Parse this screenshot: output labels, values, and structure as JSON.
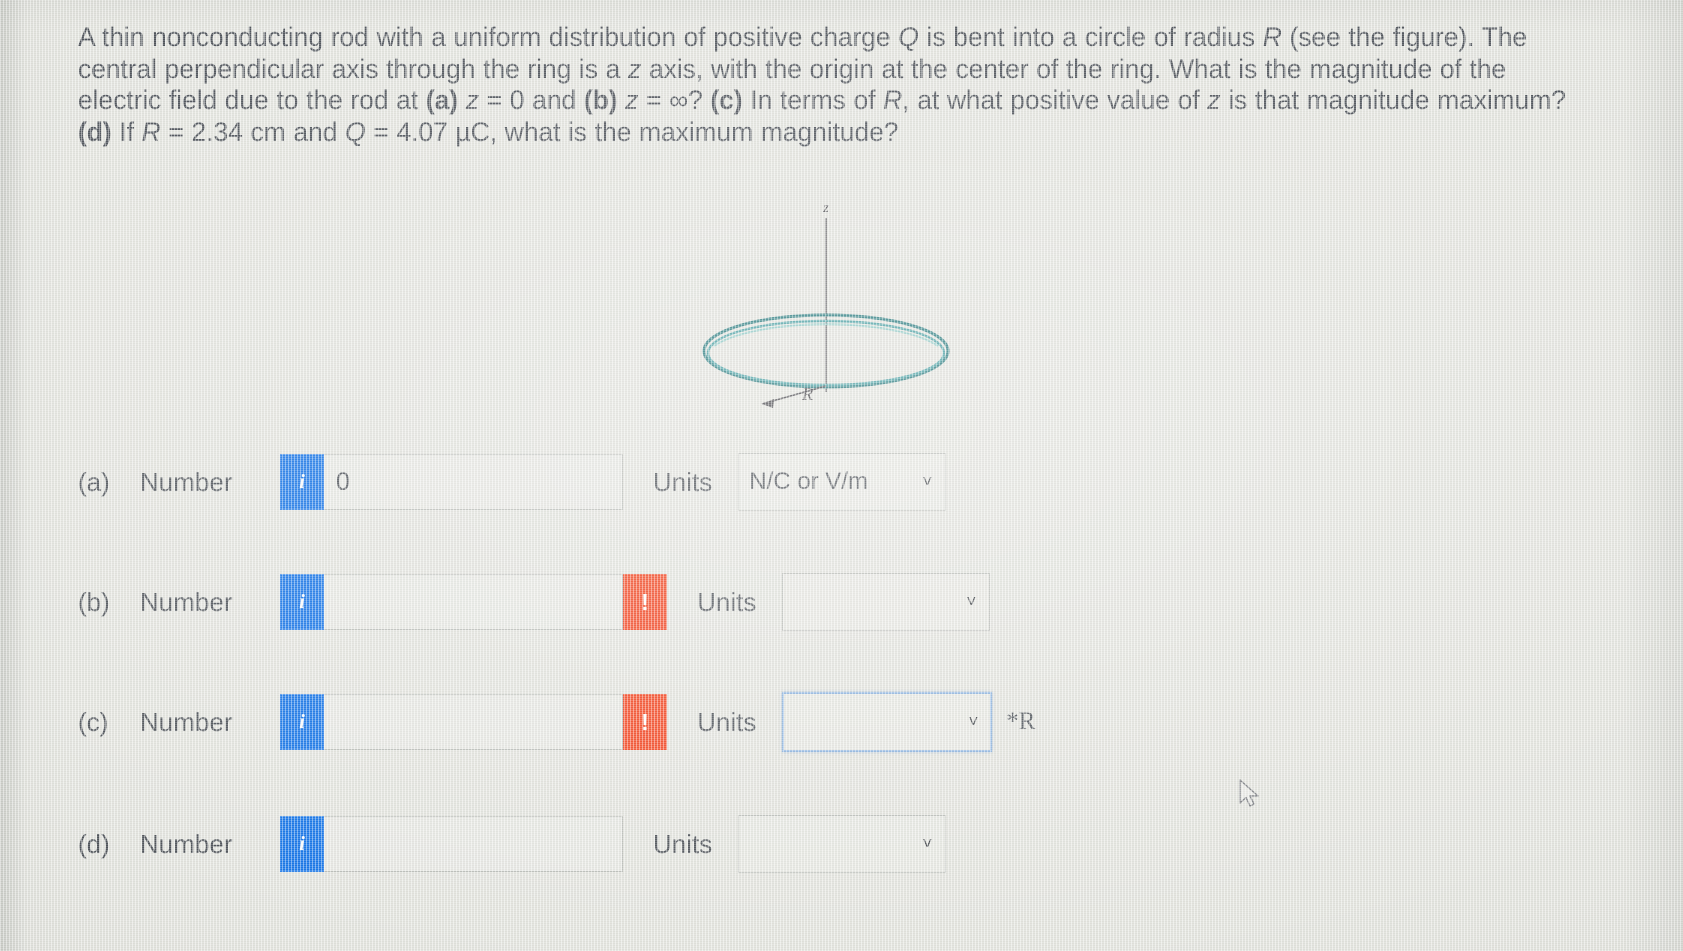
{
  "problem": {
    "line1_a": "A thin nonconducting rod with a uniform distribution of positive charge ",
    "q1": "Q",
    "line1_b": " is bent into a circle of radius ",
    "r1": "R",
    "line1_c": " (see the figure). The central",
    "line2_a": "perpendicular axis through the ring is a ",
    "z1": "z",
    "line2_b": " axis, with the origin at the center of the ring. What is the magnitude of the electric field due to",
    "line3_a": "the rod at ",
    "bold_a": "(a)",
    "line3_b": " ",
    "z2": "z",
    "line3_c": " = 0 and ",
    "bold_b": "(b)",
    "line3_d": " ",
    "z3": "z",
    "line3_e": " = ∞? ",
    "bold_c": "(c)",
    "line3_f": " In terms of ",
    "r2": "R",
    "line3_g": ", at what positive value of ",
    "z4": "z",
    "line3_h": " is that magnitude maximum? ",
    "bold_d": "(d)",
    "line3_i": " If ",
    "r3": "R",
    "line3_j": " = 2.34 cm and ",
    "q2": "Q",
    "line3_k": " = 4.07",
    "line4_a": "µC, what is the maximum magnitude?"
  },
  "figure": {
    "axis_label": "z",
    "radius_label": "R",
    "ring_color": "#2d7f82",
    "axis_color": "#5c5a5e"
  },
  "rows": [
    {
      "part": "(a)",
      "number_label": "Number",
      "info_icon": "info-icon",
      "info_text": "i",
      "value": "0",
      "placeholder": "",
      "has_error": false,
      "error_text": "!",
      "units_label": "Units",
      "units_value": "N/C or V/m",
      "caret_icon": "chevron-down-icon",
      "caret": "˅",
      "focused": false,
      "suffix": ""
    },
    {
      "part": "(b)",
      "number_label": "Number",
      "info_icon": "info-icon",
      "info_text": "i",
      "value": "",
      "placeholder": "",
      "has_error": true,
      "error_text": "!",
      "units_label": "Units",
      "units_value": "",
      "caret_icon": "chevron-down-icon",
      "caret": "˅",
      "focused": false,
      "suffix": ""
    },
    {
      "part": "(c)",
      "number_label": "Number",
      "info_icon": "info-icon",
      "info_text": "i",
      "value": "",
      "placeholder": "",
      "has_error": true,
      "error_text": "!",
      "units_label": "Units",
      "units_value": "",
      "caret_icon": "chevron-down-icon",
      "caret": "˅",
      "focused": true,
      "suffix": "*R"
    },
    {
      "part": "(d)",
      "number_label": "Number",
      "info_icon": "info-icon",
      "info_text": "i",
      "value": "",
      "placeholder": "",
      "has_error": false,
      "error_text": "!",
      "units_label": "Units",
      "units_value": "",
      "caret_icon": "chevron-down-icon",
      "caret": "˅",
      "focused": false,
      "suffix": ""
    }
  ],
  "colors": {
    "accent_blue": "#1273e8",
    "error_red": "#f4441f",
    "ring_teal": "#2d7f82",
    "page_bg": "#e2e3dd",
    "text": "#4d5258"
  },
  "cursor": {
    "icon": "mouse-pointer-icon"
  }
}
